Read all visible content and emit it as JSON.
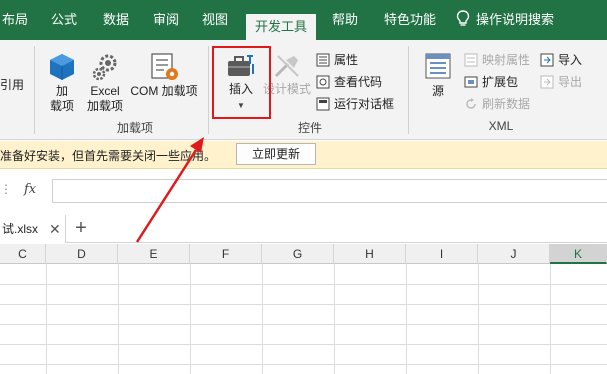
{
  "ribbon_tabs": {
    "layout": "布局",
    "formulas": "公式",
    "data": "数据",
    "review": "审阅",
    "view": "视图",
    "developer": "开发工具",
    "help": "帮助",
    "features": "特色功能",
    "search": "操作说明搜索"
  },
  "addins_group": {
    "partial_label": "引用",
    "addins_btn": [
      "加",
      "载项"
    ],
    "excel_addins_btn": [
      "Excel",
      "加载项"
    ],
    "com_addins_btn": "COM 加载项",
    "label": "加载项"
  },
  "controls_group": {
    "insert_btn": "插入",
    "design_mode_btn": "设计模式",
    "properties": "属性",
    "view_code": "查看代码",
    "run_dialog": "运行对话框",
    "label": "控件"
  },
  "xml_group": {
    "source_btn": "源",
    "map_properties": "映射属性",
    "expansion_packs": "扩展包",
    "refresh_data": "刷新数据",
    "import": "导入",
    "export": "导出",
    "label": "XML"
  },
  "message_bar": {
    "text": "准备好安装，但首先需要关闭一些应用。",
    "update_button": "立即更新"
  },
  "formula_bar": {
    "fx_label": "fx",
    "value": ""
  },
  "workbook_tab": {
    "name": "试.xlsx",
    "close": "✕",
    "add": "+"
  },
  "columns": [
    "C",
    "D",
    "E",
    "F",
    "G",
    "H",
    "I",
    "J",
    "K"
  ],
  "selected_column": "K",
  "colors": {
    "accent": "#217346",
    "highlight": "#e0191b",
    "message_bg": "#fff2cc"
  }
}
